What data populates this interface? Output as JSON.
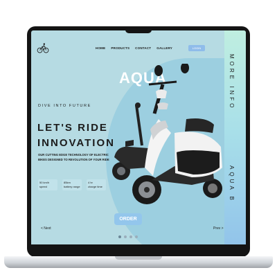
{
  "nav": {
    "items": [
      "HOME",
      "PRODUCTS",
      "CONTACT",
      "GALLERY"
    ],
    "login_label": "LOGIN"
  },
  "hero": {
    "brand": "AQUA",
    "tagline": "DIVE INTO FUTURE",
    "headline_line1": "LET'S RIDE",
    "headline_line2": "INNOVATION",
    "description": "OUR CUTTING EDGE TECHNOLOGY OF ELECTRIC BIKES DESIGNED TO REVOLUTION OF YOUR RIDE",
    "stats": [
      {
        "value": "50 km/h",
        "label": "speed"
      },
      {
        "value": "85km",
        "label": "battery range"
      },
      {
        "value": "4 hr",
        "label": "charge time"
      }
    ],
    "order_label": "ORDER"
  },
  "pagination": {
    "prev_label": "< Next",
    "next_label": "Prev >"
  },
  "side_panel": {
    "more_info": "MORE INFO",
    "aqua_b": "AQUA B"
  },
  "colors": {
    "screen_bg": "#b6dbe3",
    "accent_blue": "#93c6ec",
    "dark_text": "#1c1c1c"
  }
}
